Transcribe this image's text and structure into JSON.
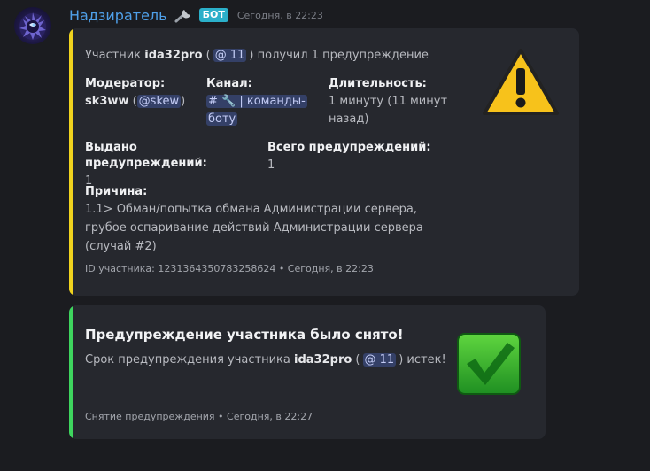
{
  "header": {
    "bot_name": "Надзиратель",
    "badge": "БОТ",
    "timestamp": "Сегодня, в 22:23"
  },
  "warning_embed": {
    "color": "#f0d31e",
    "desc_prefix": "Участник",
    "user": "ida32pro",
    "mention": "@ 11",
    "desc_suffix": "получил",
    "count": "1",
    "desc_end": "предупреждение",
    "fields": {
      "moderator": {
        "name": "Модератор:",
        "value": "sk3ww",
        "mention": "@skew"
      },
      "channel": {
        "name": "Канал:",
        "value_line1": "# 🔧 | команды-",
        "value_line2": "боту"
      },
      "duration": {
        "name": "Длительность:",
        "value_line1": "1 минуту (11 минут",
        "value_line2": "назад)"
      },
      "issued": {
        "name": "Выдано предупреждений:",
        "value": "1"
      },
      "total": {
        "name": "Всего предупреждений:",
        "value": "1"
      },
      "reason": {
        "name": "Причина:",
        "line1": "1.1> Обман/попытка обмана Администрации сервера,",
        "line2": "грубое оспаривание действий Администрации сервера",
        "line3": "(случай #2)"
      }
    },
    "footer": "ID участника: 1231364350783258624 • Сегодня, в 22:23",
    "icon": "warning-icon"
  },
  "removed_embed": {
    "color": "#3ed55e",
    "title": "Предупреждение участника было снято!",
    "desc_prefix": "Срок предупреждения участника",
    "user": "ida32pro",
    "mention": "@ 11",
    "desc_suffix": "истек!",
    "footer": "Снятие предупреждения • Сегодня, в 22:27",
    "icon": "check-mark-icon"
  }
}
